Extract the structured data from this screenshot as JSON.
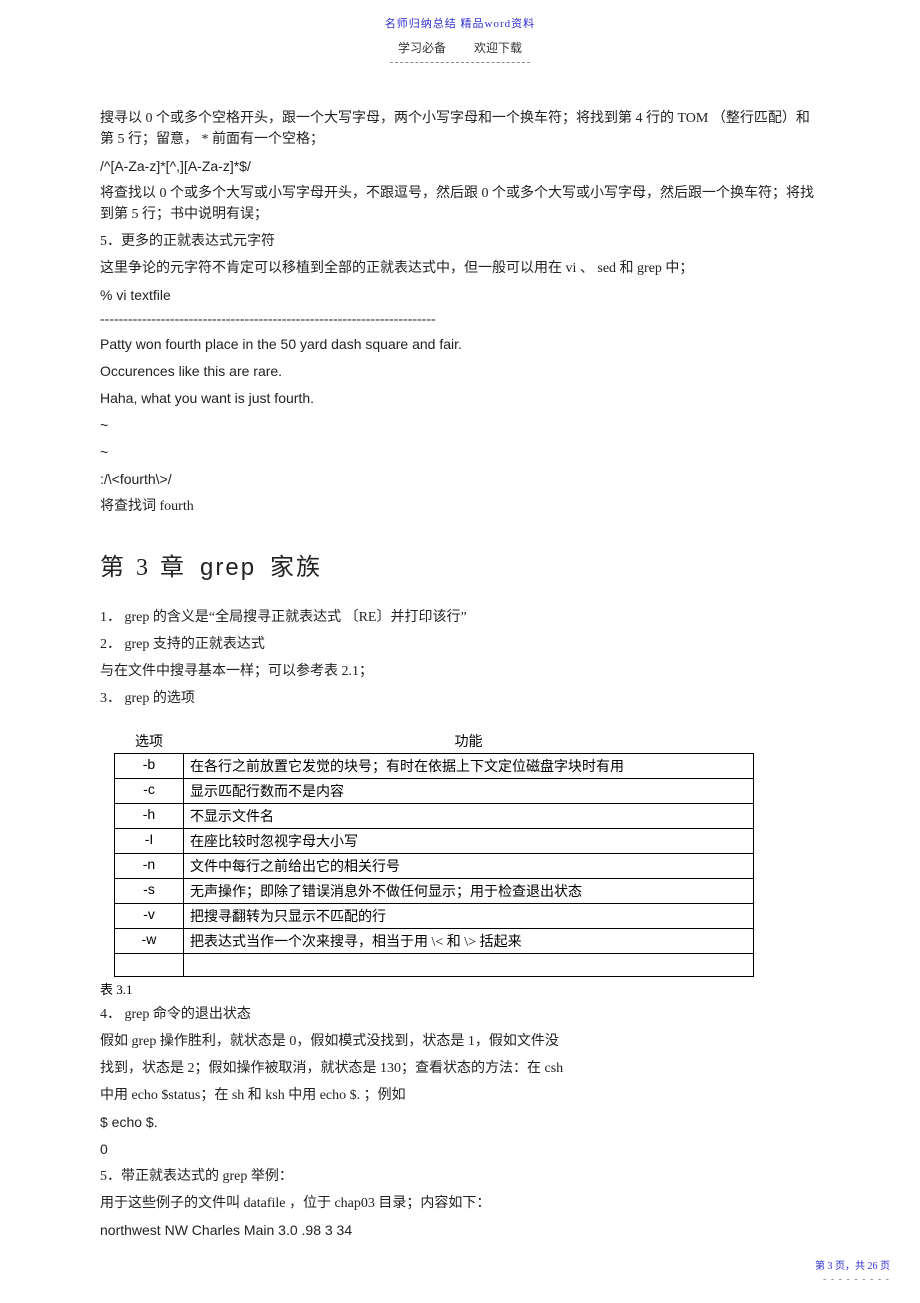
{
  "header": {
    "meta": "名师归纳总结    精品word资料",
    "sub_left": "学习必备",
    "sub_right": "欢迎下载"
  },
  "body": {
    "p1": "搜寻以   0 个或多个空格开头，跟一个大写字母，两个小写字母和一个换车符；将找到第          4 行的  TOM （整行匹配）和第   5 行；留意，   * 前面有一个空格；",
    "regex_line": "/^[A-Za-z]*[^,][A-Za-z]*$/",
    "p2": "将查找以   0 个或多个大写或小写字母开头，不跟逗号，然后跟        0 个或多个大写或小写字母，然后跟一个换车符；将找到第   5 行；书中说明有误；",
    "p3": "5．更多的正就表达式元字符",
    "p4": "这里争论的元字符不肯定可以移植到全部的正就表达式中，但一般可以用在            vi 、 sed 和  grep 中；",
    "vi_cmd": "% vi textfile",
    "sep": "------------------------------------------------------------------------",
    "tf1": "Patty won fourth place in the 50 yard dash square and fair.",
    "tf2": "Occurences like this are rare.",
    "tf3": "Haha, what you want is just fourth.",
    "tilde": "~",
    "search_cmd": ":/\\<fourth\\>/",
    "search_desc": "将查找词   fourth",
    "chapter_prefix": "第",
    "chapter_num": "3",
    "chapter_zhang": "章",
    "chapter_title": "grep",
    "chapter_suffix": "家族",
    "g1": "1． grep 的含义是“全局搜寻正就表达式    〔RE〕并打印该行”",
    "g2": "2． grep 支持的正就表达式",
    "g2b": "与在文件中搜寻基本一样；可以参考表       2.1；",
    "g3": "3． grep  的选项",
    "table": {
      "head_opt": "选项",
      "head_fn": "功能",
      "rows": [
        {
          "opt": "-b",
          "fn": "在各行之前放置它发觉的块号；有时在依据上下文定位磁盘字块时有用"
        },
        {
          "opt": "-c",
          "fn": "显示匹配行数而不是内容"
        },
        {
          "opt": "-h",
          "fn": "不显示文件名"
        },
        {
          "opt": "-I",
          "fn": "在座比较时忽视字母大小写"
        },
        {
          "opt": "-n",
          "fn": "文件中每行之前给出它的相关行号"
        },
        {
          "opt": "-s",
          "fn": "无声操作；即除了错误消息外不做任何显示；用于检查退出状态"
        },
        {
          "opt": "-v",
          "fn": "把搜寻翻转为只显示不匹配的行"
        },
        {
          "opt": "-w",
          "fn": "把表达式当作一个次来搜寻，相当于用    \\< 和 \\>  括起来"
        }
      ],
      "label": "表  3.1"
    },
    "q4a": "4． grep 命令的退出状态",
    "q4b": "假如  grep 操作胜利，就状态是     0，假如模式没找到，状态是     1，假如文件没",
    "q4c": "找到，状态是   2；假如操作被取消，就状态是     130；查看状态的方法：在     csh",
    "q4d": "中用  echo $status；在  sh 和  ksh 中用  echo $. ；例如",
    "echo_cmd": "$ echo $.",
    "echo_out": "0",
    "q5a": "5．带正就表达式的     grep 举例：",
    "q5b": "用于这些例子的文件叫     datafile ，位于   chap03 目录；内容如下：",
    "data_line": "northwest NW Charles Main 3.0 .98 3 34"
  },
  "footer": {
    "text": "第 3 页，共 26 页",
    "dash": "- - - - - - - - -"
  }
}
